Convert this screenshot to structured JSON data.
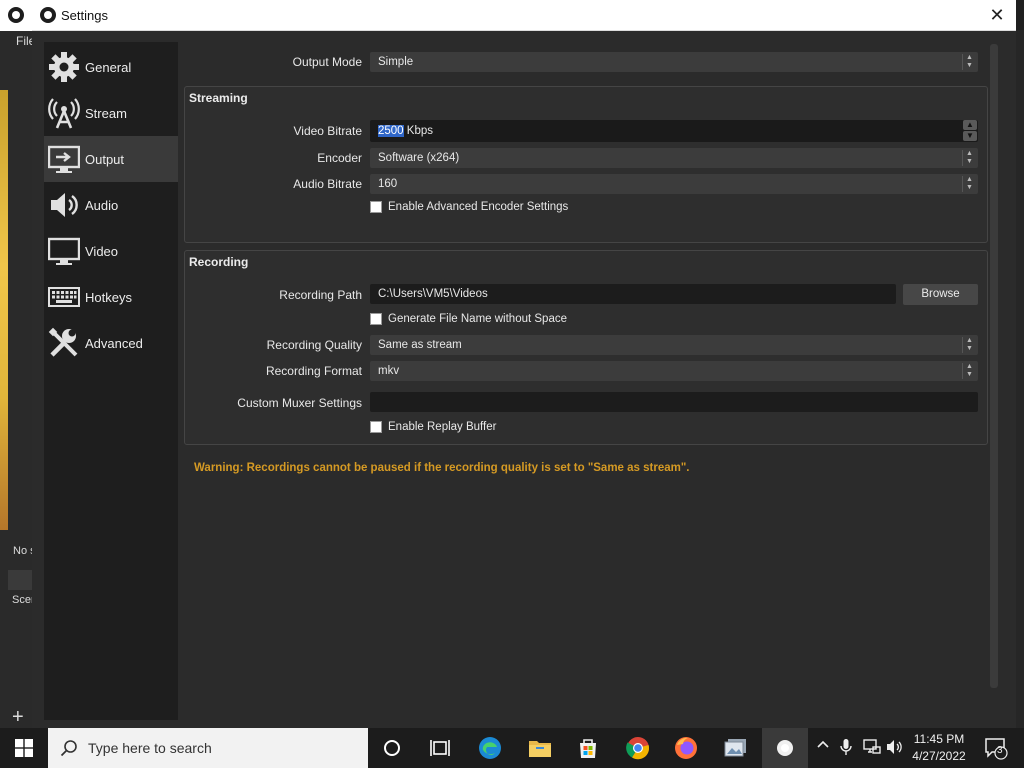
{
  "background": {
    "menu_file": "File",
    "no_source": "No s",
    "scenes": "Scen",
    "add_symbol": "+"
  },
  "dialog": {
    "title": "Settings",
    "close_symbol": "✕"
  },
  "sidebar": {
    "items": [
      {
        "label": "General",
        "icon": "gear-icon"
      },
      {
        "label": "Stream",
        "icon": "broadcast-antenna-icon"
      },
      {
        "label": "Output",
        "icon": "output-monitor-icon",
        "active": true
      },
      {
        "label": "Audio",
        "icon": "speaker-icon"
      },
      {
        "label": "Video",
        "icon": "monitor-icon"
      },
      {
        "label": "Hotkeys",
        "icon": "keyboard-icon"
      },
      {
        "label": "Advanced",
        "icon": "tools-icon"
      }
    ]
  },
  "output": {
    "mode_label": "Output Mode",
    "mode_value": "Simple",
    "streaming": {
      "title": "Streaming",
      "video_bitrate_label": "Video Bitrate",
      "video_bitrate_value": "2500",
      "video_bitrate_unit": " Kbps",
      "encoder_label": "Encoder",
      "encoder_value": "Software (x264)",
      "audio_bitrate_label": "Audio Bitrate",
      "audio_bitrate_value": "160",
      "advanced_encoder_label": "Enable Advanced Encoder Settings"
    },
    "recording": {
      "title": "Recording",
      "path_label": "Recording Path",
      "path_value": "C:\\Users\\VM5\\Videos",
      "browse_label": "Browse",
      "no_space_label": "Generate File Name without Space",
      "quality_label": "Recording Quality",
      "quality_value": "Same as stream",
      "format_label": "Recording Format",
      "format_value": "mkv",
      "muxer_label": "Custom Muxer Settings",
      "muxer_value": "",
      "replay_label": "Enable Replay Buffer"
    },
    "warning": "Warning: Recordings cannot be paused if the recording quality is set to \"Same as stream\"."
  },
  "taskbar": {
    "search_placeholder": "Type here to search",
    "time": "11:45 PM",
    "date": "4/27/2022",
    "notification_count": "3"
  },
  "colors": {
    "accent_selection": "#2f66c8",
    "warning": "#d59a24",
    "panel_bg": "#2b2b2b"
  }
}
